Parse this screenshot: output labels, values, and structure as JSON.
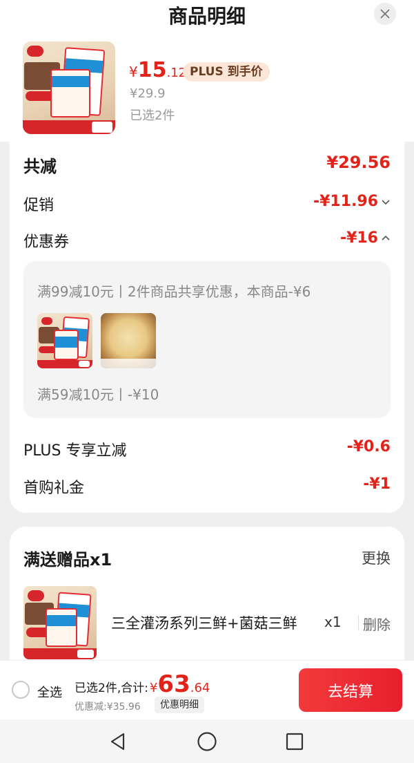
{
  "header": {
    "title": "商品明细",
    "close_icon": "close-icon"
  },
  "product": {
    "price_symbol": "¥",
    "price_int": "15",
    "price_dec": ".12",
    "plus_badge": "PLUS 到手价",
    "original_price": "¥29.9",
    "selected": "已选2件"
  },
  "discounts": {
    "total_label": "共减",
    "total_value": "¥29.56",
    "promo_label": "促销",
    "promo_value": "-¥11.96",
    "coupon_label": "优惠券",
    "coupon_value": "-¥16",
    "coupon_detail_1": "满99减10元丨2件商品共享优惠，本商品-¥6",
    "coupon_detail_2": "满59减10元丨-¥10",
    "plus_label": "PLUS 专享立减",
    "plus_value": "-¥0.6",
    "first_label": "首购礼金",
    "first_value": "-¥1"
  },
  "gift": {
    "title": "满送赠品x1",
    "change": "更换",
    "name": "三全灌汤系列三鲜+菌菇三鲜",
    "qty": "x1",
    "delete": "删除"
  },
  "footer": {
    "select_all": "全选",
    "sum_label": "已选2件,合计:",
    "sum_symbol": "¥",
    "sum_int": "63",
    "sum_dec": ".64",
    "discount": "优惠减:¥35.96",
    "detail": "优惠明细",
    "checkout": "去结算"
  },
  "colors": {
    "accent": "#e2231a",
    "plus_badge_bg": "#fbe6d7",
    "page_bg": "#efefef"
  },
  "navbar": {
    "back_icon": "triangle-back-icon",
    "home_icon": "circle-home-icon",
    "recent_icon": "square-recents-icon"
  }
}
